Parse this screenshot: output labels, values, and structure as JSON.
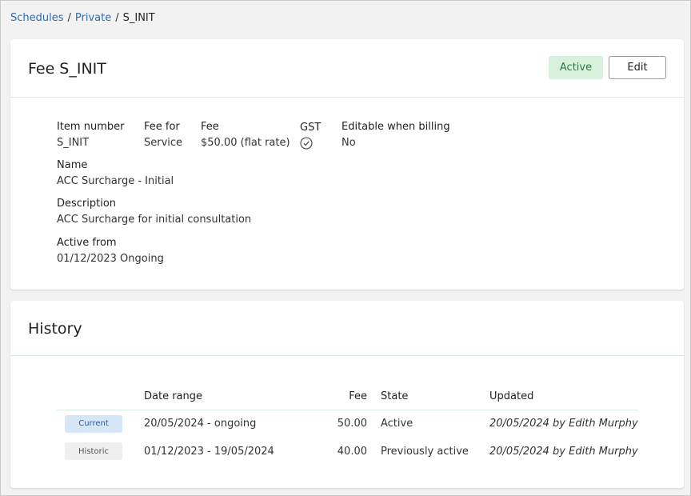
{
  "breadcrumb": {
    "items": [
      "Schedules",
      "Private"
    ],
    "separator": "/",
    "current": "S_INIT"
  },
  "fee_card": {
    "title": "Fee S_INIT",
    "status_badge": "Active",
    "edit_label": "Edit",
    "fields": {
      "item_number": {
        "label": "Item number",
        "value": "S_INIT"
      },
      "fee_for": {
        "label": "Fee for",
        "value": "Service"
      },
      "fee": {
        "label": "Fee",
        "value": "$50.00 (flat rate)"
      },
      "gst": {
        "label": "GST",
        "icon": "check-circle-icon"
      },
      "editable": {
        "label": "Editable when billing",
        "value": "No"
      },
      "name": {
        "label": "Name",
        "value": "ACC Surcharge - Initial"
      },
      "description": {
        "label": "Description",
        "value": "ACC Surcharge for initial consultation"
      },
      "active_from": {
        "label": "Active from",
        "value": "01/12/2023 Ongoing"
      }
    }
  },
  "history": {
    "title": "History",
    "columns": [
      "",
      "Date range",
      "Fee",
      "State",
      "Updated"
    ],
    "rows": [
      {
        "status": "Current",
        "date_range": "20/05/2024 - ongoing",
        "fee": "50.00",
        "state": "Active",
        "updated": "20/05/2024 by Edith Murphy"
      },
      {
        "status": "Historic",
        "date_range": "01/12/2023 - 19/05/2024",
        "fee": "40.00",
        "state": "Previously active",
        "updated": "20/05/2024 by Edith Murphy"
      }
    ]
  },
  "colors": {
    "link": "#2d6cb5",
    "active_badge_bg": "#d8f1dc",
    "active_badge_text": "#2b7a3a",
    "current_pill_bg": "#d6e6f7",
    "historic_pill_bg": "#efefef"
  }
}
